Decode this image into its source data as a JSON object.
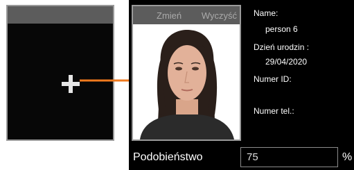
{
  "left_slot": {
    "add_icon": "plus-icon"
  },
  "arrow": {
    "color": "#f07a1e"
  },
  "photo": {
    "change_label": "Zmień",
    "clear_label": "Wyczyść"
  },
  "person": {
    "name_label": "Name:",
    "name_value": "person 6",
    "birth_label": "Dzień urodzin :",
    "birth_value": "29/04/2020",
    "id_label": "Numer ID:",
    "phone_label": "Numer tel.:"
  },
  "similarity": {
    "label": "Podobieństwo",
    "value": "75",
    "unit": "%"
  }
}
